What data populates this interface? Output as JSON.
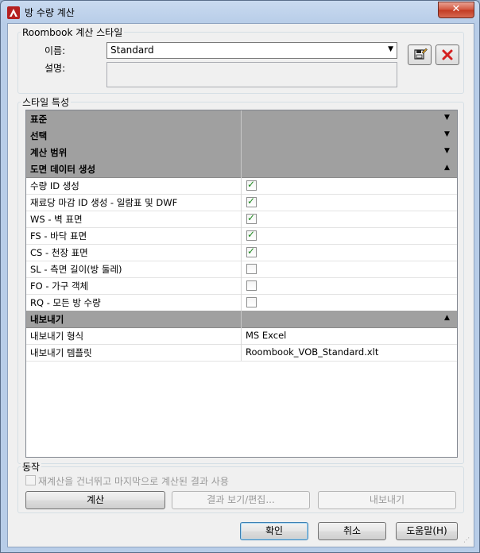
{
  "window": {
    "title": "방 수량 계산",
    "close": "✕"
  },
  "style_group": {
    "title": "Roombook 계산 스타일",
    "name_label": "이름:",
    "name_value": "Standard",
    "desc_label": "설명:",
    "desc_value": ""
  },
  "properties": {
    "title": "스타일 특성",
    "rows": [
      {
        "type": "cat",
        "label": "표준",
        "value": "",
        "caret": "▼"
      },
      {
        "type": "cat",
        "label": "선택",
        "value": "",
        "caret": "▼"
      },
      {
        "type": "cat",
        "label": "계산 범위",
        "value": "",
        "caret": "▼"
      },
      {
        "type": "cat",
        "label": "도면 데이터 생성",
        "value": "",
        "caret": "▲"
      },
      {
        "type": "check",
        "label": "수량 ID 생성",
        "checked": true
      },
      {
        "type": "check",
        "label": "재료당 마감 ID 생성 - 일람표 및 DWF",
        "checked": true
      },
      {
        "type": "check",
        "label": "WS - 벽 표면",
        "checked": true
      },
      {
        "type": "check",
        "label": "FS - 바닥 표면",
        "checked": true
      },
      {
        "type": "check",
        "label": "CS - 천장 표면",
        "checked": true
      },
      {
        "type": "check",
        "label": "SL - 측면 길이(방 둘레)",
        "checked": false
      },
      {
        "type": "check",
        "label": "FO - 가구 객체",
        "checked": false
      },
      {
        "type": "check",
        "label": "RQ - 모든 방 수량",
        "checked": false
      },
      {
        "type": "cat",
        "label": "내보내기",
        "value": "",
        "caret": "▲"
      },
      {
        "type": "text",
        "label": "내보내기 형식",
        "value": "MS Excel"
      },
      {
        "type": "text",
        "label": "내보내기 템플릿",
        "value": "Roombook_VOB_Standard.xlt"
      }
    ]
  },
  "actions": {
    "title": "동작",
    "skip_label": "재계산을 건너뛰고 마지막으로 계산된 결과 사용",
    "calculate": "계산",
    "view_edit": "결과 보기/편집...",
    "export": "내보내기"
  },
  "footer": {
    "ok": "확인",
    "cancel": "취소",
    "help": "도움말(H)"
  },
  "colors": {
    "accent_red": "#c0392b",
    "category_bg": "#a0a0a0",
    "check_green": "#1e8a1e"
  }
}
